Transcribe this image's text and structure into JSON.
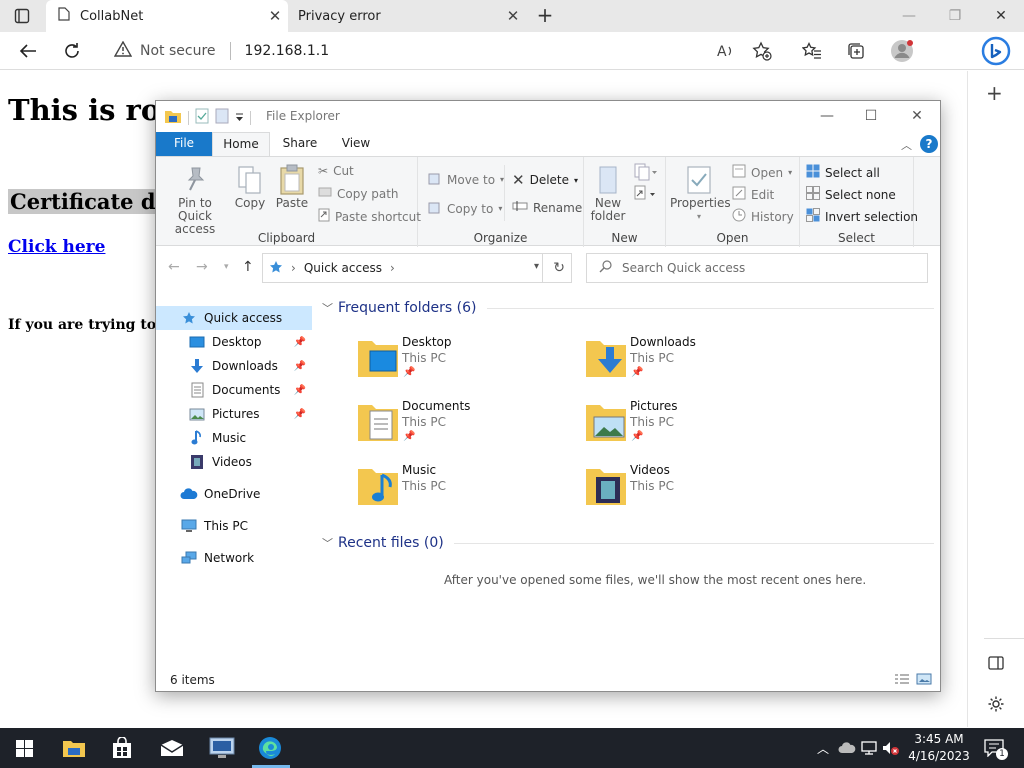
{
  "browser": {
    "tabs": [
      {
        "title": "CollabNet",
        "close": "✕"
      },
      {
        "title": "Privacy error",
        "close": "✕"
      }
    ],
    "new_tab": "+",
    "address": {
      "security_label": "Not secure",
      "url": "192.168.1.1"
    }
  },
  "page": {
    "heading": "This is rou",
    "subheading": "Certificate dov",
    "link": "Click here",
    "paragraph": "If you are trying to in"
  },
  "explorer": {
    "title": "File Explorer",
    "ribbon_tabs": [
      "File",
      "Home",
      "Share",
      "View"
    ],
    "ribbon": {
      "clipboard": {
        "label": "Clipboard",
        "pin": "Pin to Quick\naccess",
        "copy": "Copy",
        "paste": "Paste",
        "cut": "Cut",
        "copy_path": "Copy path",
        "paste_shortcut": "Paste shortcut"
      },
      "organize": {
        "label": "Organize",
        "move_to": "Move to",
        "copy_to": "Copy to",
        "delete": "Delete",
        "rename": "Rename"
      },
      "new": {
        "label": "New",
        "new_folder": "New\nfolder"
      },
      "open": {
        "label": "Open",
        "properties": "Properties",
        "open": "Open",
        "edit": "Edit",
        "history": "History"
      },
      "select": {
        "label": "Select",
        "select_all": "Select all",
        "select_none": "Select none",
        "invert": "Invert selection"
      }
    },
    "address_path": "Quick access",
    "search_placeholder": "Search Quick access",
    "nav_pane": [
      {
        "label": "Quick access"
      },
      {
        "label": "Desktop"
      },
      {
        "label": "Downloads"
      },
      {
        "label": "Documents"
      },
      {
        "label": "Pictures"
      },
      {
        "label": "Music"
      },
      {
        "label": "Videos"
      },
      {
        "label": "OneDrive"
      },
      {
        "label": "This PC"
      },
      {
        "label": "Network"
      }
    ],
    "frequent_header": "Frequent folders (6)",
    "folders": [
      {
        "name": "Desktop",
        "location": "This PC"
      },
      {
        "name": "Downloads",
        "location": "This PC"
      },
      {
        "name": "Documents",
        "location": "This PC"
      },
      {
        "name": "Pictures",
        "location": "This PC"
      },
      {
        "name": "Music",
        "location": "This PC"
      },
      {
        "name": "Videos",
        "location": "This PC"
      }
    ],
    "recent_header": "Recent files (0)",
    "recent_empty": "After you've opened some files, we'll show the most recent ones here.",
    "status": "6 items"
  },
  "taskbar": {
    "time": "3:45 AM",
    "date": "4/16/2023",
    "notification_count": "1"
  },
  "colors": {
    "accent": "#1979ca",
    "taskbar": "#1e2229",
    "selection": "#cce8ff",
    "folder": "#f3c74f"
  }
}
